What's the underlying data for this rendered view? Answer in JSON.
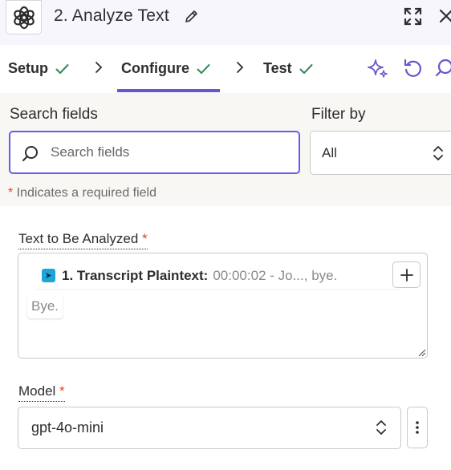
{
  "header": {
    "title": "2. Analyze Text",
    "logo_icon": "openai-logo-icon",
    "edit_icon": "pencil-icon",
    "expand_icon": "expand-icon",
    "close_icon": "close-icon"
  },
  "tabs": [
    {
      "label": "Setup",
      "status_icon": "check-icon",
      "active": false
    },
    {
      "label": "Configure",
      "status_icon": "check-icon",
      "active": true
    },
    {
      "label": "Test",
      "status_icon": "check-icon",
      "active": false
    }
  ],
  "toolbar": {
    "icons": [
      "sparkle-icon",
      "undo-icon",
      "search-icon"
    ]
  },
  "search": {
    "label": "Search fields",
    "placeholder": "Search fields",
    "value": ""
  },
  "filter": {
    "label": "Filter by",
    "value": "All"
  },
  "required_note": {
    "star": "*",
    "text": " Indicates a required field"
  },
  "fields": {
    "text_to_analyze": {
      "label": "Text to Be Analyzed",
      "required_star": "*",
      "pill_name": "1. Transcript Plaintext:",
      "pill_value": "00:00:02 - Jo..., bye.",
      "second_line": "Bye."
    },
    "model": {
      "label": "Model",
      "required_star": "*",
      "value": "gpt-4o-mini"
    }
  },
  "colors": {
    "accent": "#6757cb",
    "check_green": "#2e8b57",
    "required_red": "#d94826",
    "header_bg": "#f7f6fd",
    "search_bg": "#f8f7f4"
  }
}
